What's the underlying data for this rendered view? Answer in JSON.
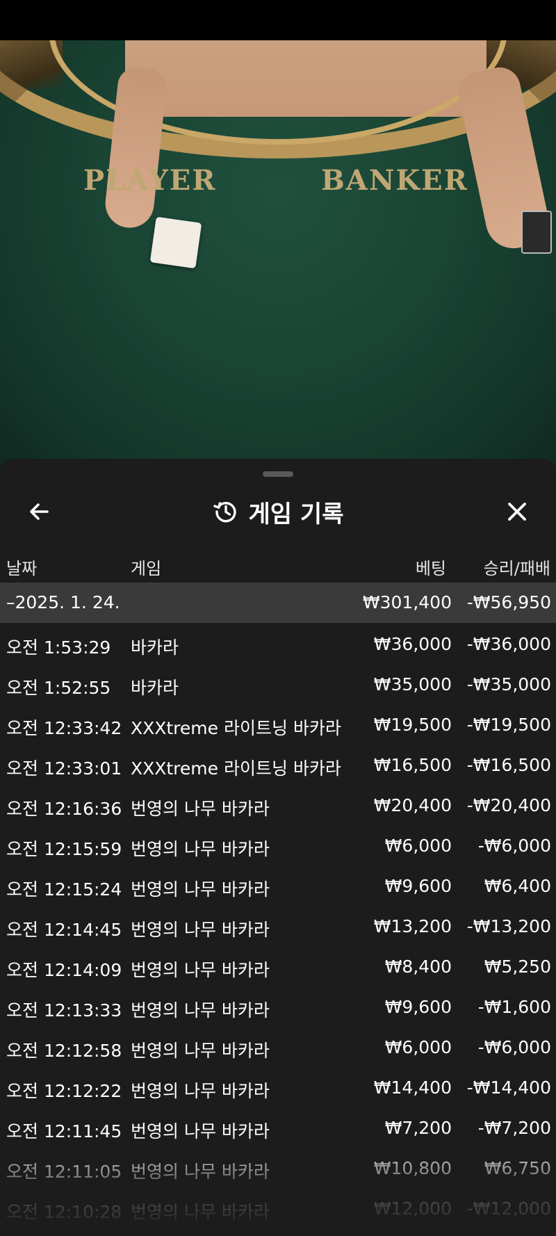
{
  "video": {
    "felt_player": "PLAYER",
    "felt_banker": "BANKER"
  },
  "sheet": {
    "title": "게임 기록",
    "icons": {
      "back": "arrow-left-icon",
      "history": "history-icon",
      "close": "close-icon"
    }
  },
  "columns": {
    "date": "날짜",
    "game": "게임",
    "bet": "베팅",
    "win_loss": "승리/패배"
  },
  "day_summary": {
    "date": "–2025. 1. 24.",
    "bet": "₩301,400",
    "win_loss": "-₩56,950"
  },
  "rows": [
    {
      "time": "오전 1:53:29",
      "game": "바카라",
      "bet": "₩36,000",
      "win_loss": "-₩36,000"
    },
    {
      "time": "오전 1:52:55",
      "game": "바카라",
      "bet": "₩35,000",
      "win_loss": "-₩35,000"
    },
    {
      "time": "오전 12:33:42",
      "game": "XXXtreme 라이트닝 바카라",
      "bet": "₩19,500",
      "win_loss": "-₩19,500"
    },
    {
      "time": "오전 12:33:01",
      "game": "XXXtreme 라이트닝 바카라",
      "bet": "₩16,500",
      "win_loss": "-₩16,500"
    },
    {
      "time": "오전 12:16:36",
      "game": "번영의 나무 바카라",
      "bet": "₩20,400",
      "win_loss": "-₩20,400"
    },
    {
      "time": "오전 12:15:59",
      "game": "번영의 나무 바카라",
      "bet": "₩6,000",
      "win_loss": "-₩6,000"
    },
    {
      "time": "오전 12:15:24",
      "game": "번영의 나무 바카라",
      "bet": "₩9,600",
      "win_loss": "₩6,400"
    },
    {
      "time": "오전 12:14:45",
      "game": "번영의 나무 바카라",
      "bet": "₩13,200",
      "win_loss": "-₩13,200"
    },
    {
      "time": "오전 12:14:09",
      "game": "번영의 나무 바카라",
      "bet": "₩8,400",
      "win_loss": "₩5,250"
    },
    {
      "time": "오전 12:13:33",
      "game": "번영의 나무 바카라",
      "bet": "₩9,600",
      "win_loss": "-₩1,600"
    },
    {
      "time": "오전 12:12:58",
      "game": "번영의 나무 바카라",
      "bet": "₩6,000",
      "win_loss": "-₩6,000"
    },
    {
      "time": "오전 12:12:22",
      "game": "번영의 나무 바카라",
      "bet": "₩14,400",
      "win_loss": "-₩14,400"
    },
    {
      "time": "오전 12:11:45",
      "game": "번영의 나무 바카라",
      "bet": "₩7,200",
      "win_loss": "-₩7,200"
    },
    {
      "time": "오전 12:11:05",
      "game": "번영의 나무 바카라",
      "bet": "₩10,800",
      "win_loss": "₩6,750"
    },
    {
      "time": "오전 12:10:28",
      "game": "번영의 나무 바카라",
      "bet": "₩12,000",
      "win_loss": "-₩12,000"
    }
  ]
}
